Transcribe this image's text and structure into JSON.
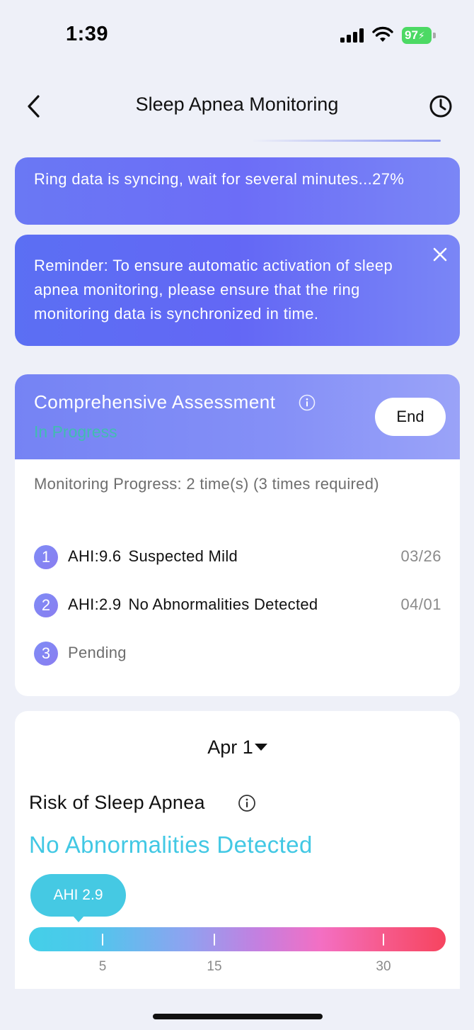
{
  "status_bar": {
    "time": "1:39",
    "battery": "97"
  },
  "nav": {
    "title": "Sleep Apnea Monitoring",
    "back_icon": "chevron-left-icon",
    "history_icon": "clock-icon"
  },
  "sync_banner": {
    "text": "Ring data is syncing, wait for several minutes...27%",
    "progress_percent": 27
  },
  "reminder_banner": {
    "text": "Reminder: To ensure automatic activation of sleep apnea monitoring, please ensure that the ring monitoring data is synchronized in time.",
    "close_icon": "close-icon"
  },
  "assessment": {
    "title": "Comprehensive Assessment",
    "status": "In Progress",
    "end_label": "End",
    "progress_text": "Monitoring Progress: 2 time(s) (3 times required)",
    "records": [
      {
        "num": "1",
        "ahi": "AHI:9.6",
        "severity": "Suspected Mild",
        "date": "03/26"
      },
      {
        "num": "2",
        "ahi": "AHI:2.9",
        "severity": "No Abnormalities Detected",
        "date": "04/01"
      },
      {
        "num": "3",
        "label": "Pending"
      }
    ]
  },
  "risk": {
    "date": "Apr 1",
    "title": "Risk of Sleep Apnea",
    "result": "No Abnormalities Detected",
    "ahi_label": "AHI 2.9",
    "ahi_value": 2.9,
    "scale_ticks": [
      "5",
      "15",
      "30"
    ]
  },
  "colors": {
    "accent_blue": "#6a78f4",
    "result_cyan": "#42c8e4",
    "status_green": "#2fcf9a",
    "battery_green": "#4cd964"
  }
}
